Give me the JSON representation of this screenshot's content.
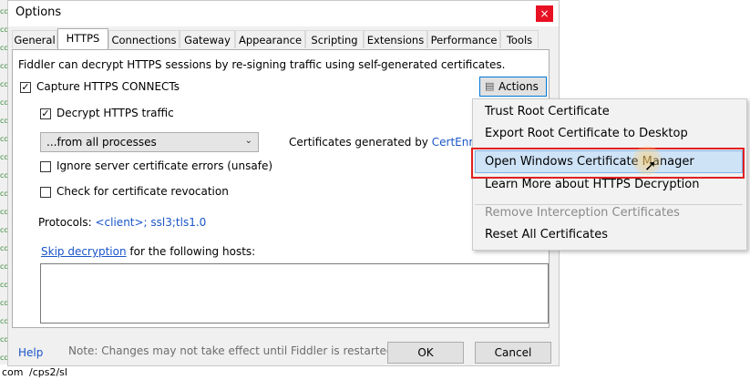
{
  "window": {
    "title": "Options",
    "close": "×"
  },
  "tabs": [
    "General",
    "HTTPS",
    "Connections",
    "Gateway",
    "Appearance",
    "Scripting",
    "Extensions",
    "Performance",
    "Tools"
  ],
  "https": {
    "intro": "Fiddler can decrypt HTTPS sessions by re-signing traffic using self-generated certificates.",
    "capture_label": "Capture HTTPS CONNECTs",
    "decrypt_label": "Decrypt HTTPS traffic",
    "process_filter": "...from all processes",
    "cert_generated_prefix": "Certificates generated by",
    "cert_generated_link": "CertEnroll",
    "ignore_errors_label": "Ignore server certificate errors (unsafe)",
    "revocation_label": "Check for certificate revocation",
    "protocols_label": "Protocols:",
    "protocols_value": "<client>; ssl3;tls1.0",
    "skip_link": "Skip decryption",
    "skip_rest": "for the following hosts:",
    "actions_label": "Actions"
  },
  "footer": {
    "help": "Help",
    "note": "Note: Changes may not take effect until Fiddler is restarted.",
    "ok": "OK",
    "cancel": "Cancel"
  },
  "menu": {
    "items": [
      "Trust Root Certificate",
      "Export Root Certificate to Desktop",
      "Open Windows Certificate Manager",
      "Learn More about HTTPS Decryption",
      "Remove Interception Certificates",
      "Reset All Certificates"
    ]
  },
  "background": {
    "bottom_left": "com",
    "bottom_path": "/cps2/sl"
  },
  "colors": {
    "highlight_border": "#e02020",
    "link": "#1a55c8"
  }
}
